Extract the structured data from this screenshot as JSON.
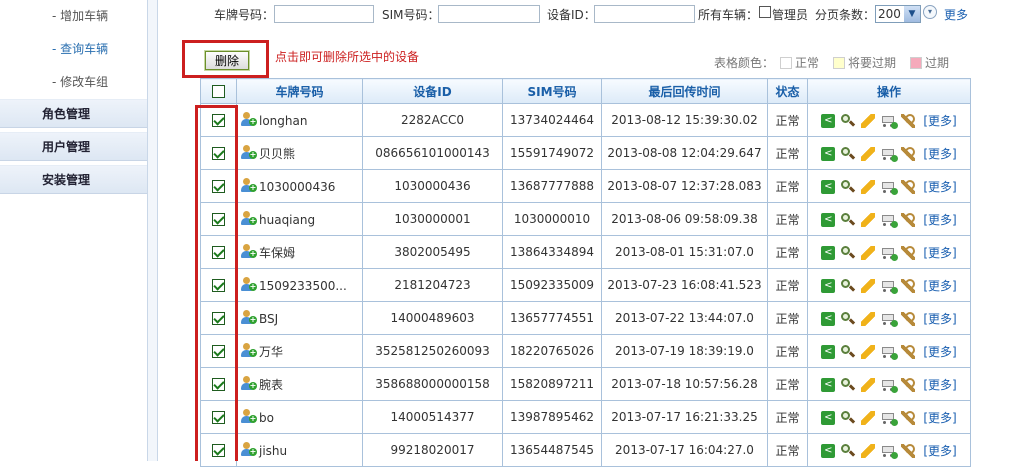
{
  "sidebar": {
    "sub_items": [
      {
        "label": "- 增加车辆",
        "active": false
      },
      {
        "label": "- 查询车辆",
        "active": true
      },
      {
        "label": "- 修改车组",
        "active": false
      }
    ],
    "sections": [
      "角色管理",
      "用户管理",
      "安装管理"
    ]
  },
  "search": {
    "plate_label": "车牌号码：",
    "sim_label": "SIM号码：",
    "device_label": "设备ID：",
    "all_vehicles_label": "所有车辆：",
    "admin_label": "管理员",
    "page_size_label": "分页条数：",
    "page_size_value": "200",
    "more_label": "更多"
  },
  "actions": {
    "delete_label": "删除",
    "delete_hint": "点击即可删除所选中的设备"
  },
  "legend": {
    "title": "表格颜色：",
    "items": [
      {
        "label": "正常",
        "color": "#ffffff"
      },
      {
        "label": "将要过期",
        "color": "#ffffcc"
      },
      {
        "label": "过期",
        "color": "#f5aabb"
      }
    ]
  },
  "table": {
    "headers": [
      "车牌号码",
      "设备ID",
      "SIM号码",
      "最后回传时间",
      "状态",
      "操作"
    ],
    "more_link": "[更多]",
    "rows": [
      {
        "checked": true,
        "plate": "longhan",
        "device_id": "2282ACC0",
        "sim": "13734024464",
        "last_time": "2013-08-12 15:39:30.02",
        "status": "正常"
      },
      {
        "checked": true,
        "plate": "贝贝熊",
        "device_id": "086656101000143",
        "sim": "15591749072",
        "last_time": "2013-08-08 12:04:29.647",
        "status": "正常"
      },
      {
        "checked": true,
        "plate": "1030000436",
        "device_id": "1030000436",
        "sim": "13687777888",
        "last_time": "2013-08-07 12:37:28.083",
        "status": "正常"
      },
      {
        "checked": true,
        "plate": "huaqiang",
        "device_id": "1030000001",
        "sim": "1030000010",
        "last_time": "2013-08-06 09:58:09.38",
        "status": "正常"
      },
      {
        "checked": true,
        "plate": "车保姆",
        "device_id": "3802005495",
        "sim": "13864334894",
        "last_time": "2013-08-01 15:31:07.0",
        "status": "正常"
      },
      {
        "checked": true,
        "plate": "1509233500...",
        "device_id": "2181204723",
        "sim": "15092335009",
        "last_time": "2013-07-23 16:08:41.523",
        "status": "正常"
      },
      {
        "checked": true,
        "plate": "BSJ",
        "device_id": "14000489603",
        "sim": "13657774551",
        "last_time": "2013-07-22 13:44:07.0",
        "status": "正常"
      },
      {
        "checked": true,
        "plate": "万华",
        "device_id": "352581250260093",
        "sim": "18220765026",
        "last_time": "2013-07-19 18:39:19.0",
        "status": "正常"
      },
      {
        "checked": true,
        "plate": "腕表",
        "device_id": "358688000000158",
        "sim": "15820897211",
        "last_time": "2013-07-18 10:57:56.28",
        "status": "正常"
      },
      {
        "checked": true,
        "plate": "bo",
        "device_id": "14000514377",
        "sim": "13987895462",
        "last_time": "2013-07-17 16:21:33.25",
        "status": "正常"
      },
      {
        "checked": true,
        "plate": "jishu",
        "device_id": "99218020017",
        "sim": "13654487545",
        "last_time": "2013-07-17 16:04:27.0",
        "status": "正常"
      }
    ]
  },
  "icons": [
    "share-icon",
    "locate-icon",
    "edit-icon",
    "cart-add-icon",
    "wrench-icon"
  ]
}
